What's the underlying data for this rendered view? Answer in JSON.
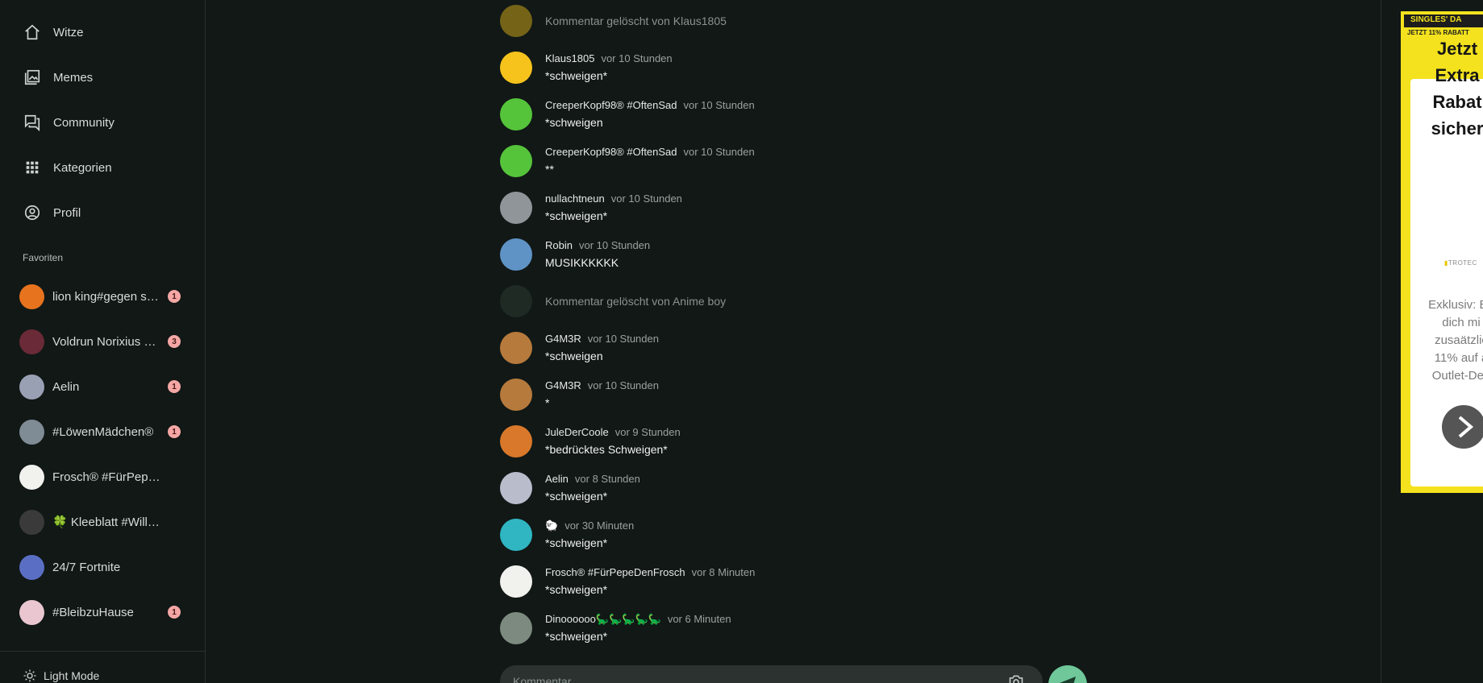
{
  "nav": {
    "items": [
      {
        "label": "Witze",
        "icon": "home-icon"
      },
      {
        "label": "Memes",
        "icon": "images-icon"
      },
      {
        "label": "Community",
        "icon": "forum-icon"
      },
      {
        "label": "Kategorien",
        "icon": "grid-icon"
      },
      {
        "label": "Profil",
        "icon": "account-circle-icon"
      }
    ]
  },
  "favorites": {
    "heading": "Favoriten",
    "items": [
      {
        "label": "lion king#gegen sp…",
        "badge": "1",
        "color": "#e8731e"
      },
      {
        "label": "Voldrun Norixius 🕷️🏹",
        "badge": "3",
        "color": "#6a2a38"
      },
      {
        "label": "Aelin",
        "badge": "1",
        "color": "#9aa0b4"
      },
      {
        "label": "#LöwenMädchen®",
        "badge": "1",
        "color": "#7f8c96"
      },
      {
        "label": "Frosch® #FürPepeDe…",
        "badge": "",
        "color": "#f1f1ee"
      },
      {
        "label": "🍀 Kleeblatt #WillWied…",
        "badge": "",
        "color": "#3a3a3a"
      },
      {
        "label": "24/7 Fortnite",
        "badge": "",
        "color": "#5a6fc4"
      },
      {
        "label": "#BleibzuHause",
        "badge": "1",
        "color": "#e9c6d0"
      }
    ]
  },
  "sidebar_footer": {
    "light_mode_label": "Light Mode"
  },
  "comments": [
    {
      "deleted": true,
      "deleted_text": "Kommentar gelöscht von Klaus1805",
      "avatar_color": "#c9a31a"
    },
    {
      "user": "Klaus1805",
      "time": "vor 10 Stunden",
      "text": "*schweigen*",
      "avatar_color": "#f5c31b"
    },
    {
      "user": "CreeperKopf98® #OftenSad",
      "time": "vor 10 Stunden",
      "text": "*schweigen",
      "avatar_color": "#55c43a"
    },
    {
      "user": "CreeperKopf98® #OftenSad",
      "time": "vor 10 Stunden",
      "text": "**",
      "avatar_color": "#55c43a"
    },
    {
      "user": "nullachtneun",
      "time": "vor 10 Stunden",
      "text": "*schweigen*",
      "avatar_color": "#8f9598"
    },
    {
      "user": "Robin",
      "time": "vor 10 Stunden",
      "text": "MUSIKKKKKK",
      "avatar_color": "#5f93c6"
    },
    {
      "deleted": true,
      "deleted_text": "Kommentar gelöscht von Anime boy",
      "avatar_color": "#2c3a33"
    },
    {
      "user": "G4M3R",
      "time": "vor 10 Stunden",
      "text": "*schweigen",
      "avatar_color": "#b67a3c"
    },
    {
      "user": "G4M3R",
      "time": "vor 10 Stunden",
      "text": "*",
      "avatar_color": "#b67a3c"
    },
    {
      "user": "JuleDerCoole",
      "time": "vor 9 Stunden",
      "text": "*bedrücktes Schweigen*",
      "avatar_color": "#d9782a"
    },
    {
      "user": "Aelin",
      "time": "vor 8 Stunden",
      "text": "*schweigen*",
      "avatar_color": "#b9bccb"
    },
    {
      "user": "🐑",
      "time": "vor 30 Minuten",
      "text": "*schweigen*",
      "avatar_color": "#2fb6c2"
    },
    {
      "user": "Frosch® #FürPepeDenFrosch",
      "time": "vor 8 Minuten",
      "text": "*schweigen*",
      "avatar_color": "#f1f1ee"
    },
    {
      "user": "Dinoooooo🦕🦕🦕🦕🦕",
      "time": "vor 6 Minuten",
      "text": "*schweigen*",
      "avatar_color": "#7d8a80"
    }
  ],
  "comment_input": {
    "placeholder": "Kommentar"
  },
  "ad": {
    "banner": "SINGLES' DA",
    "sub": "JETZT 11% RABATT",
    "headline_lines": [
      "Jetzt",
      "Extra",
      "Rabat",
      "sicher"
    ],
    "logo": "TROTEC",
    "body_lines": [
      "Exklusiv: Be",
      "dich mi",
      "zusaätzlic",
      "11% auf a",
      "Outlet-Dea"
    ]
  },
  "colors": {
    "background": "#111816",
    "accent": "#6fc79a",
    "badge": "#f4a7a5",
    "ad_yellow": "#f3e21d"
  }
}
